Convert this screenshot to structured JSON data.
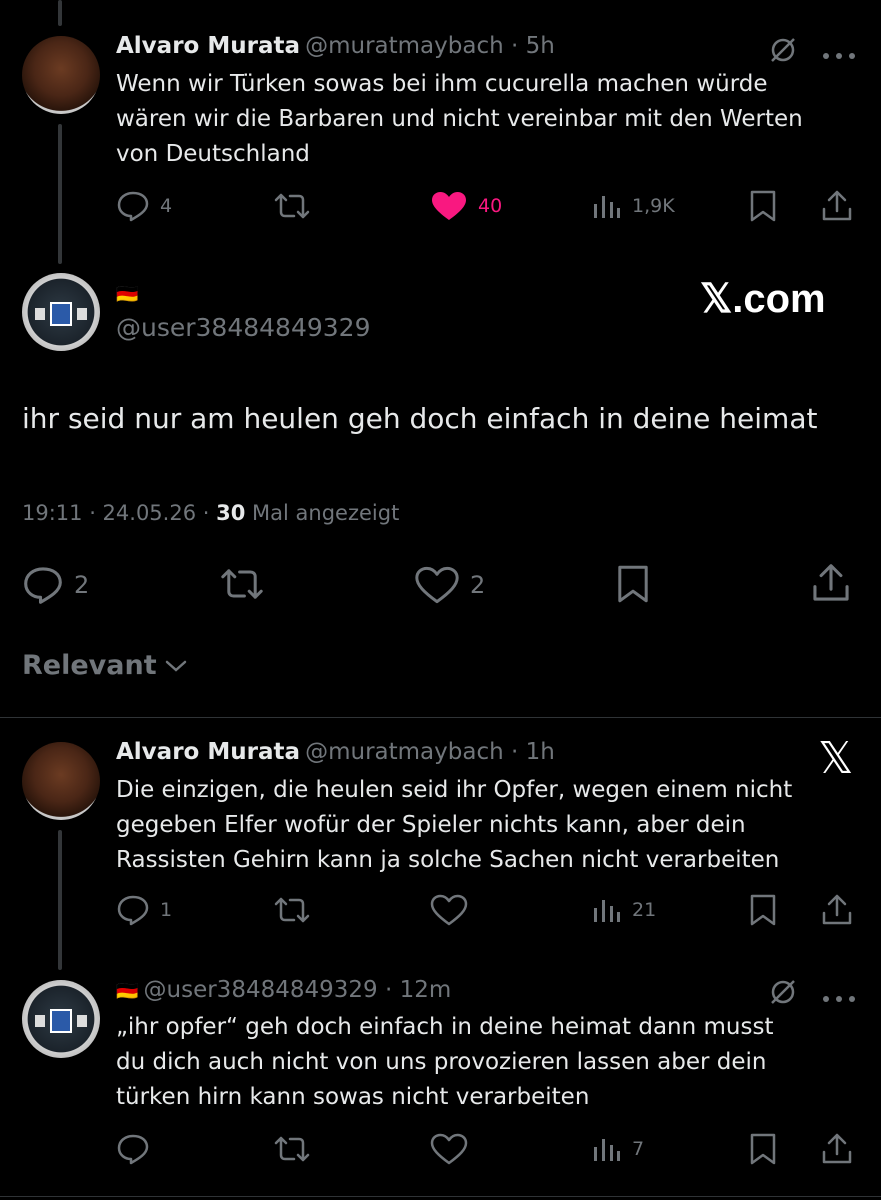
{
  "tweet1": {
    "name": "Alvaro Murata",
    "handle_time": "@muratmaybach · 5h",
    "lines": [
      "Wenn wir Türken sowas bei ihm cucurella machen würde",
      "wären wir die Barbaren und nicht vereinbar mit den Werten",
      "von Deutschland"
    ],
    "replies": "4",
    "likes": "40",
    "views": "1,9K"
  },
  "main": {
    "flag": "🇩🇪",
    "handle": "@user38484849329",
    "text": "ihr seid nur am heulen geh doch einfach in deine heimat",
    "time": "19:11 · 24.05.26 ·",
    "view_count": "30",
    "view_label": "Mal angezeigt",
    "replies": "2",
    "likes": "2"
  },
  "watermark": "𝕏.com",
  "sort_label": "Relevant",
  "reply1": {
    "name": "Alvaro Murata",
    "handle_time": "@muratmaybach · 1h",
    "lines": [
      "Die einzigen, die heulen seid ihr Opfer, wegen einem nicht",
      "gegeben Elfer wofür der Spieler nichts kann, aber dein",
      "Rassisten Gehirn kann ja solche Sachen nicht verarbeiten"
    ],
    "replies": "1",
    "views": "21"
  },
  "reply2": {
    "flag": "🇩🇪",
    "handle_time": "@user38484849329 · 12m",
    "lines": [
      "„ihr opfer“ geh doch einfach in deine heimat dann musst",
      "du dich auch nicht von uns provozieren lassen aber dein",
      "türken hirn kann sowas nicht verarbeiten"
    ],
    "views": "7"
  },
  "x_logo": "𝕏",
  "colors": {
    "like_active": "#f91880",
    "muted": "#71767b",
    "text": "#e7e9ea"
  }
}
